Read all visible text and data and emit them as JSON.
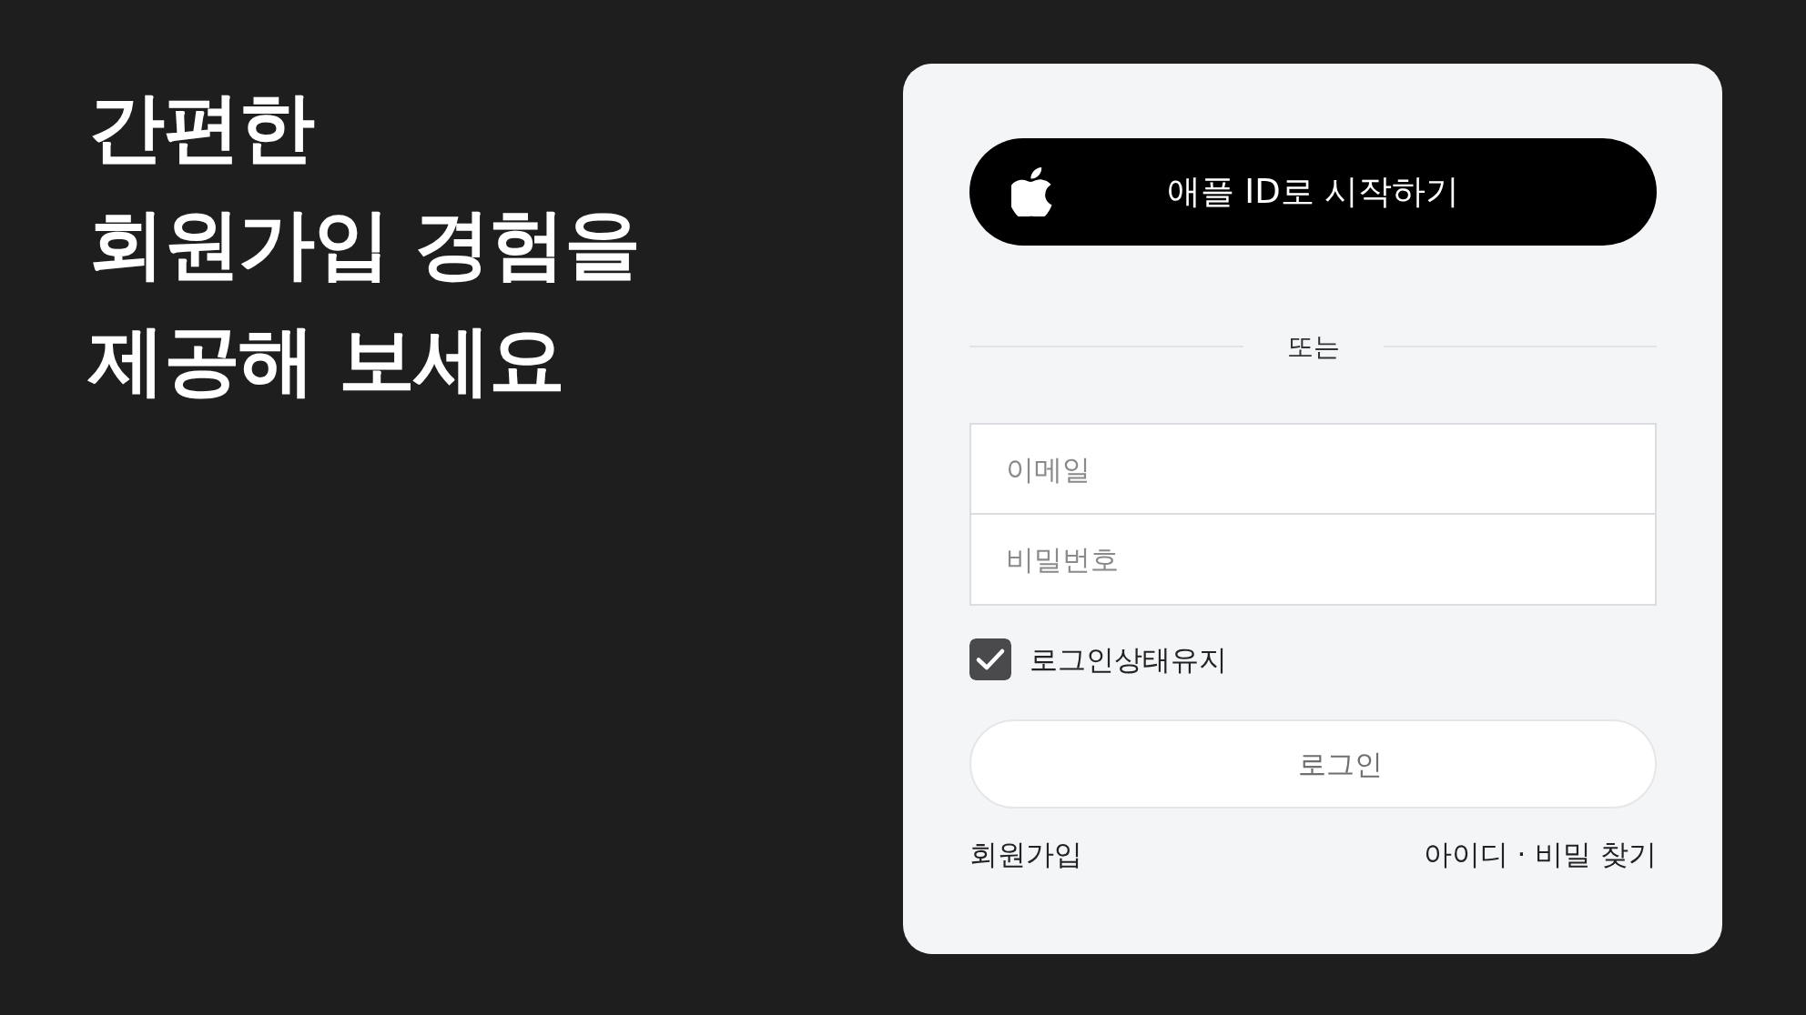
{
  "headline": [
    "간편한",
    "회원가입 경험을",
    "제공해 보세요"
  ],
  "login_card": {
    "apple_button": {
      "label": "애플 ID로 시작하기"
    },
    "divider": {
      "label": "또는"
    },
    "fields": [
      {
        "placeholder": "이메일"
      },
      {
        "placeholder": "비밀번호"
      }
    ],
    "keep_signed_in": {
      "label": "로그인상태유지",
      "checked": true
    },
    "login_button": {
      "label": "로그인"
    },
    "links": [
      {
        "label": "회원가입"
      },
      {
        "label": "아이디 · 비밀 찾기"
      }
    ]
  }
}
